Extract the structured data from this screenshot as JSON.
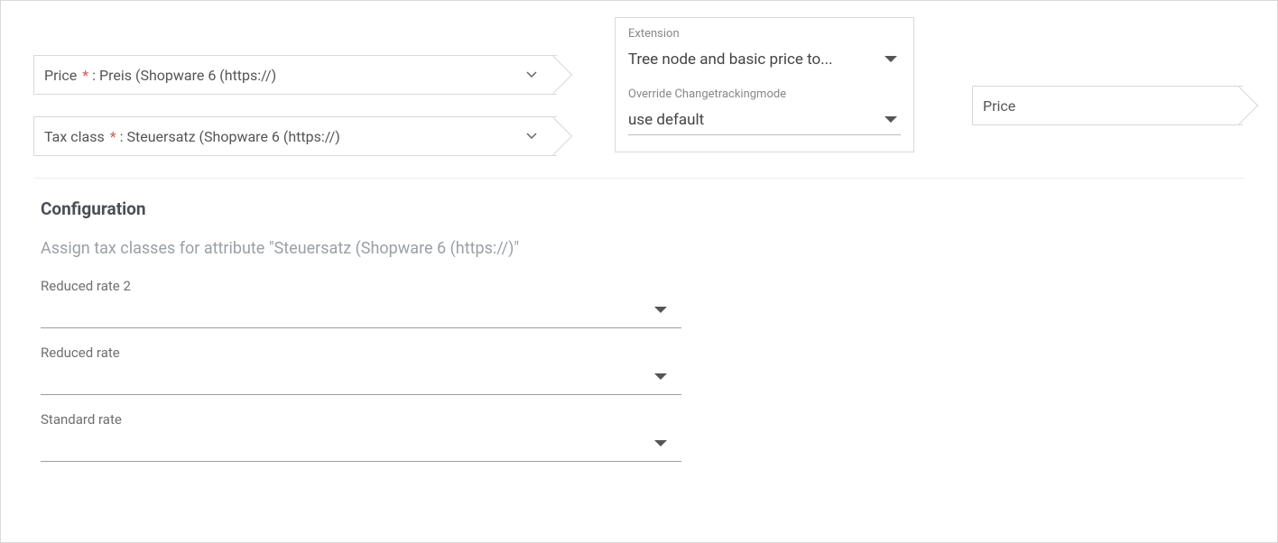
{
  "top": {
    "price": {
      "label": "Price",
      "required_marker": "*",
      "colon": ":",
      "value": "Preis (Shopware 6 (https://)"
    },
    "tax_class": {
      "label": "Tax class",
      "required_marker": "*",
      "colon": ":",
      "value": "Steuersatz (Shopware 6 (https://)"
    },
    "extension": {
      "label": "Extension",
      "value": "Tree node and basic price to..."
    },
    "override_ctm": {
      "label": "Override Changetrackingmode",
      "value": "use default"
    },
    "chip_value": "Price"
  },
  "config": {
    "heading": "Configuration",
    "subtitle": "Assign tax classes for attribute \"Steuersatz (Shopware 6 (https://)\"",
    "rates": [
      {
        "label": "Reduced rate 2",
        "value": ""
      },
      {
        "label": "Reduced rate",
        "value": ""
      },
      {
        "label": "Standard rate",
        "value": ""
      }
    ]
  }
}
